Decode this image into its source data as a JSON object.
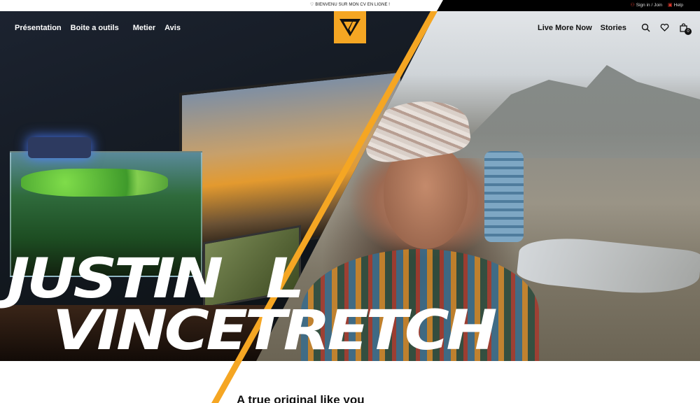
{
  "announcement": {
    "text": "BIENVENU SUR MON CV EN LIGNE !"
  },
  "account": {
    "signin_label": "Sign in / Join",
    "help_label": "Help"
  },
  "nav": {
    "left": [
      "Présentation",
      "Boite a outils",
      "Metier",
      "Avis"
    ],
    "right": [
      "Live More Now",
      "Stories"
    ]
  },
  "cart": {
    "count": "0"
  },
  "hero": {
    "headline_line1": "JUSTIN",
    "headline_line1b": "L",
    "headline_line2": "VINCETRETCH"
  },
  "section": {
    "title": "A true original like you"
  },
  "colors": {
    "accent": "#f5a623",
    "topbar": "#000000",
    "nav_text_dark": "#111111"
  },
  "icons": [
    "heart-icon",
    "user-icon",
    "help-icon",
    "search-icon",
    "wishlist-heart-icon",
    "bag-icon",
    "logo-v-icon"
  ]
}
